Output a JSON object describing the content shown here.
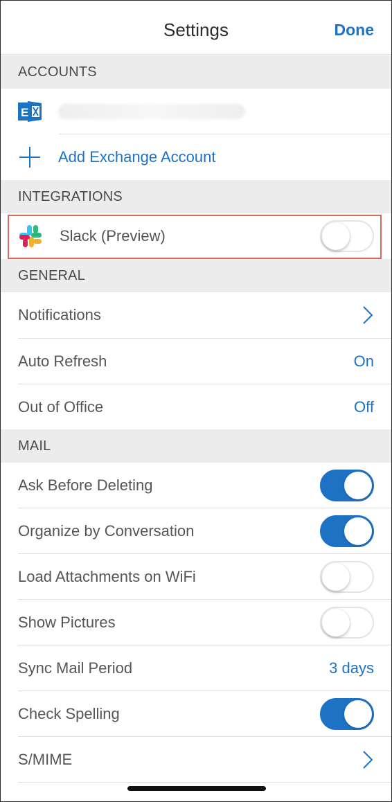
{
  "navbar": {
    "title": "Settings",
    "done_label": "Done"
  },
  "accounts": {
    "header": "ACCOUNTS",
    "account_email": "",
    "add_label": "Add Exchange Account"
  },
  "integrations": {
    "header": "INTEGRATIONS",
    "slack_label": "Slack (Preview)",
    "slack_enabled": false
  },
  "general": {
    "header": "GENERAL",
    "notifications_label": "Notifications",
    "auto_refresh_label": "Auto Refresh",
    "auto_refresh_value": "On",
    "out_of_office_label": "Out of Office",
    "out_of_office_value": "Off"
  },
  "mail": {
    "header": "MAIL",
    "items": [
      {
        "label": "Ask Before Deleting",
        "type": "toggle",
        "on": true
      },
      {
        "label": "Organize by Conversation",
        "type": "toggle",
        "on": true
      },
      {
        "label": "Load Attachments on WiFi",
        "type": "toggle",
        "on": false
      },
      {
        "label": "Show Pictures",
        "type": "toggle",
        "on": false
      },
      {
        "label": "Sync Mail Period",
        "type": "value",
        "value": "3 days"
      },
      {
        "label": "Check Spelling",
        "type": "toggle",
        "on": true
      },
      {
        "label": "S/MIME",
        "type": "chevron"
      }
    ]
  },
  "colors": {
    "accent": "#1d72c4",
    "highlight": "#e2675e",
    "section_bg": "#ececec"
  }
}
